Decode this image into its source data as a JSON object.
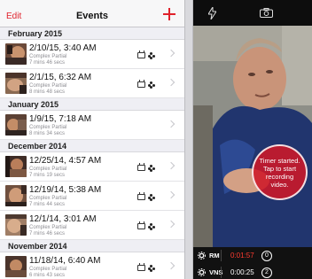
{
  "nav": {
    "edit_label": "Edit",
    "title": "Events"
  },
  "sections": [
    {
      "title": "February 2015",
      "rows": [
        {
          "date": "2/10/15, 3:40 AM",
          "type": "Complex Partial",
          "duration": "7 mins 46 secs"
        },
        {
          "date": "2/1/15, 6:32 AM",
          "type": "Complex Partial",
          "duration": "8 mins 48 secs"
        }
      ]
    },
    {
      "title": "January 2015",
      "rows": [
        {
          "date": "1/9/15, 7:18 AM",
          "type": "Complex Partial",
          "duration": "8 mins 34 secs"
        }
      ]
    },
    {
      "title": "December 2014",
      "rows": [
        {
          "date": "12/25/14, 4:57 AM",
          "type": "Complex Partial",
          "duration": "7 mins 19 secs"
        },
        {
          "date": "12/19/14, 5:38 AM",
          "type": "Complex Partial",
          "duration": "7 mins 44 secs"
        },
        {
          "date": "12/1/14, 3:01 AM",
          "type": "Complex Partial",
          "duration": "7 mins 46 secs"
        }
      ]
    },
    {
      "title": "November 2014",
      "rows": [
        {
          "date": "11/18/14, 6:40 AM",
          "type": "Complex Partial",
          "duration": "6 mins 43 secs"
        }
      ]
    }
  ],
  "camera": {
    "bubble_text": "Timer started. Tap to start recording video.",
    "rows": [
      {
        "label": "RM",
        "time": "0:01:57",
        "count": "0",
        "time_color": "#ff3b30"
      },
      {
        "label": "VNS",
        "time": "0:00:25",
        "count": "2",
        "time_color": "#ffffff"
      }
    ]
  },
  "colors": {
    "accent": "#e0212b"
  }
}
